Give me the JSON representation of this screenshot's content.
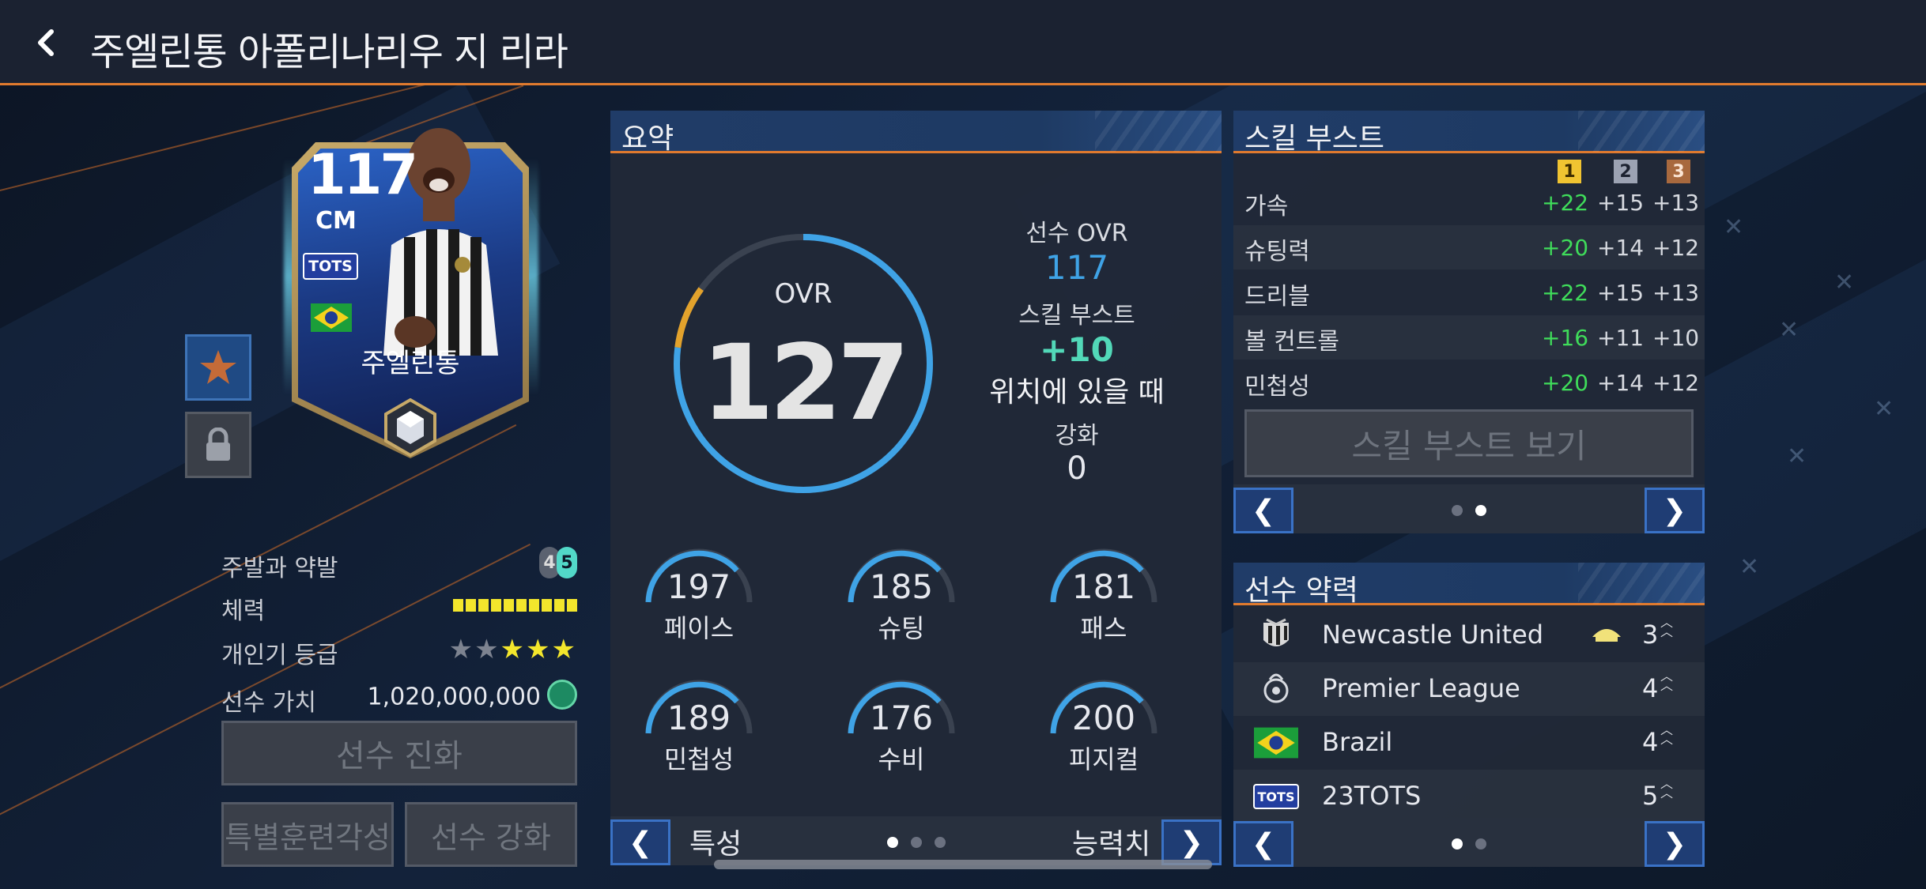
{
  "header": {
    "title": "주엘린통 아폴리나리우 지 리라"
  },
  "card": {
    "ovr": "117",
    "position": "CM",
    "season_badge": "TOTS",
    "name": "주엘린통"
  },
  "info": {
    "foot_label": "주발과 약발",
    "foot_main": "4",
    "foot_weak": "5",
    "stamina_label": "체력",
    "stamina_fraction": 1.0,
    "popularity_label": "개인기 등급",
    "popularity_stars": 3,
    "popularity_max": 5,
    "value_label": "선수 가치",
    "value": "1,020,000,000"
  },
  "buttons": {
    "evolve": "선수 진화",
    "special_training": "특별훈련각성",
    "enhance": "선수 강화"
  },
  "summary": {
    "title": "요약",
    "ovr_label": "OVR",
    "ovr_value": "127",
    "ovr_fill_fraction": 0.85,
    "player_ovr_label": "선수 OVR",
    "player_ovr_value": "117",
    "skill_boost_label": "스킬 부스트",
    "skill_boost_value": "+10",
    "position_text": "위치에 있을 때",
    "enhance_label": "강화",
    "enhance_value": "0",
    "stats": [
      {
        "label": "페이스",
        "value": "197"
      },
      {
        "label": "슈팅",
        "value": "185"
      },
      {
        "label": "패스",
        "value": "181"
      },
      {
        "label": "민첩성",
        "value": "189"
      },
      {
        "label": "수비",
        "value": "176"
      },
      {
        "label": "피지컬",
        "value": "200"
      }
    ],
    "footer_left": "특성",
    "footer_right": "능력치",
    "prev_arrow": "❮",
    "next_arrow": "❯"
  },
  "skill_boost": {
    "title": "스킬 부스트",
    "ranks": [
      "1",
      "2",
      "3"
    ],
    "rows": [
      {
        "name": "가속",
        "v1": "+22",
        "v2": "+15",
        "v3": "+13"
      },
      {
        "name": "슈팅력",
        "v1": "+20",
        "v2": "+14",
        "v3": "+12"
      },
      {
        "name": "드리블",
        "v1": "+22",
        "v2": "+15",
        "v3": "+13"
      },
      {
        "name": "볼 컨트롤",
        "v1": "+16",
        "v2": "+11",
        "v3": "+10"
      },
      {
        "name": "민첩성",
        "v1": "+20",
        "v2": "+14",
        "v3": "+12"
      }
    ],
    "view_button": "스킬 부스트 보기",
    "prev_arrow": "❮",
    "next_arrow": "❯"
  },
  "chemistry": {
    "title": "선수 약력",
    "rows": [
      {
        "name": "Newcastle United",
        "level": "3"
      },
      {
        "name": "Premier League",
        "level": "4"
      },
      {
        "name": "Brazil",
        "level": "4"
      },
      {
        "name": "23TOTS",
        "level": "5",
        "badge": "TOTS"
      }
    ],
    "prev_arrow": "❮",
    "next_arrow": "❯"
  },
  "colors": {
    "accent_orange": "#e07a2e",
    "ovr_blue": "#3fa3e6",
    "boost_green": "#52d8b8",
    "skill_green": "#3fdc5a",
    "star_yellow": "#f3e62c"
  }
}
